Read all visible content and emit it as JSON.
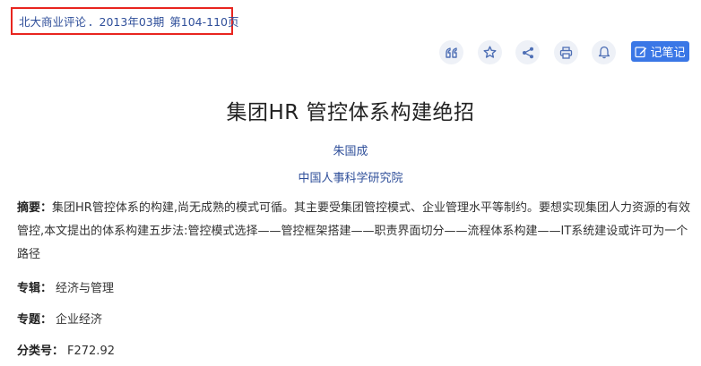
{
  "source": {
    "journal": "北大商业评论",
    "separator": "．",
    "issue": "2013年03期",
    "pages": "第104-110页"
  },
  "toolbar": {
    "icons": [
      "quote-icon",
      "star-icon",
      "share-icon",
      "print-icon",
      "bell-icon"
    ],
    "note_label": "记笔记",
    "accent_color": "#3a77e6"
  },
  "article": {
    "title": "集团HR 管控体系构建绝招",
    "author": "朱国成",
    "organization": "中国人事科学研究院"
  },
  "metadata": {
    "abstract_label": "摘要：",
    "abstract_text": "集团HR管控体系的构建,尚无成熟的模式可循。其主要受集团管控模式、企业管理水平等制约。要想实现集团人力资源的有效管控,本文提出的体系构建五步法:管控模式选择——管控框架搭建——职责界面切分——流程体系构建——IT系统建设或许可为一个路径",
    "zhuanji_label": "专辑：",
    "zhuanji_value": "经济与管理",
    "zhuanti_label": "专题：",
    "zhuanti_value": "企业经济",
    "fenlei_label": "分类号：",
    "fenlei_value": "F272.92"
  },
  "colors": {
    "highlight_border": "#e8251f",
    "link": "#2f4f9a",
    "icon_bg": "#eef1f7",
    "icon_fg": "#4e6fb5"
  }
}
